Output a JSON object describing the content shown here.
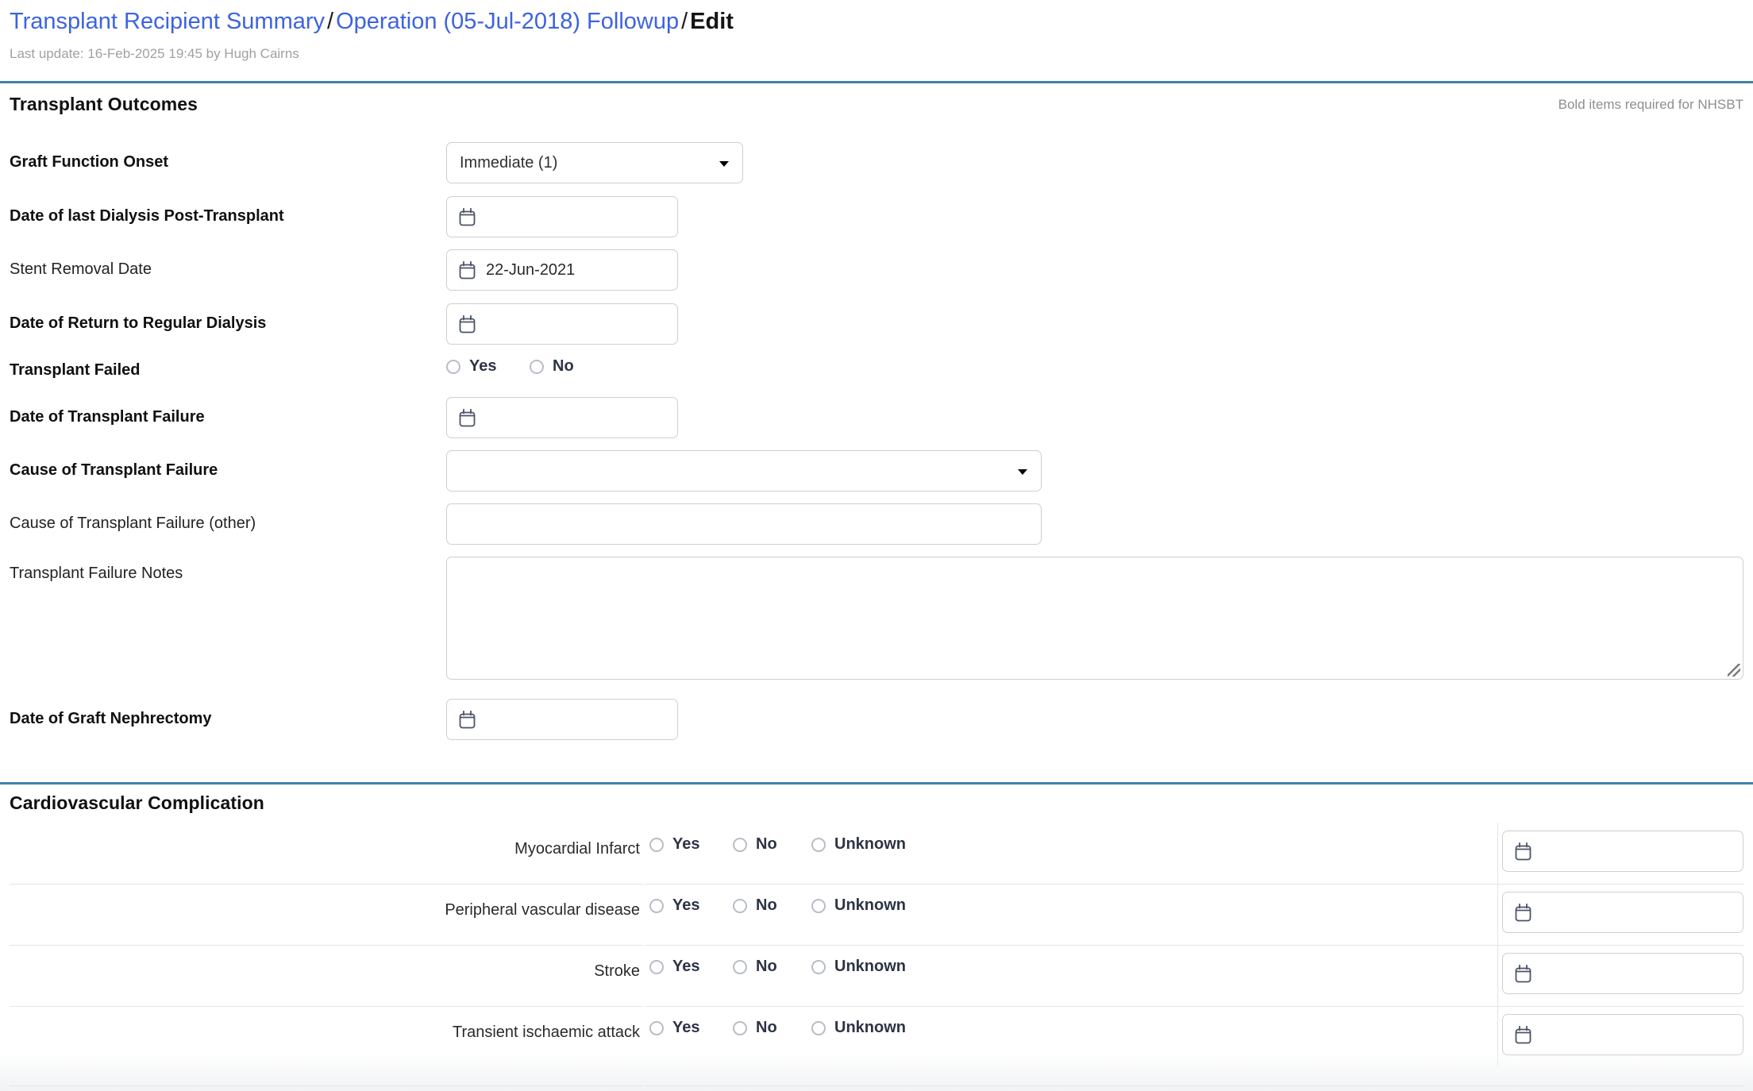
{
  "breadcrumb": {
    "items": [
      {
        "label": "Transplant Recipient Summary",
        "type": "link"
      },
      {
        "label": "Operation (05-Jul-2018) Followup",
        "type": "link"
      },
      {
        "label": "Edit",
        "type": "current"
      }
    ],
    "separator": "/",
    "link_color": "#3d63e0"
  },
  "meta": {
    "last_update": "Last update: 16-Feb-2025 19:45 by Hugh Cairns"
  },
  "sections": {
    "outcomes": {
      "title": "Transplant Outcomes",
      "note": "Bold items required for NHSBT",
      "rows": {
        "graft_function_onset": {
          "label": "Graft Function Onset",
          "value": "Immediate (1)"
        },
        "date_last_dialysis": {
          "label": "Date of last Dialysis Post-Transplant",
          "value": ""
        },
        "stent_removal": {
          "label": "Stent Removal Date",
          "value": "22-Jun-2021"
        },
        "date_return_dialysis": {
          "label": "Date of Return to Regular Dialysis",
          "value": ""
        },
        "transplant_failed": {
          "label": "Transplant Failed",
          "options": [
            "Yes",
            "No"
          ],
          "selected": ""
        },
        "date_transplant_failure": {
          "label": "Date of Transplant Failure",
          "value": ""
        },
        "cause_failure": {
          "label": "Cause of Transplant Failure",
          "value": ""
        },
        "cause_failure_other": {
          "label": "Cause of Transplant Failure (other)",
          "value": ""
        },
        "failure_notes": {
          "label": "Transplant Failure Notes",
          "value": ""
        },
        "date_graft_nephrectomy": {
          "label": "Date of Graft Nephrectomy",
          "value": ""
        }
      }
    },
    "cardiovascular": {
      "title": "Cardiovascular Complication",
      "options": [
        "Yes",
        "No",
        "Unknown"
      ],
      "rows": [
        {
          "label": "Myocardial Infarct",
          "selected": "",
          "date": ""
        },
        {
          "label": "Peripheral vascular disease",
          "selected": "",
          "date": ""
        },
        {
          "label": "Stroke",
          "selected": "",
          "date": ""
        },
        {
          "label": "Transient ischaemic attack",
          "selected": "",
          "date": ""
        }
      ]
    }
  },
  "icons": {
    "calendar": "calendar-icon",
    "caret": "chevron-down-icon",
    "resize": "resize-grip-icon"
  },
  "colors": {
    "rule_blue": "#4281a6",
    "link": "#3d63e0",
    "muted": "#a0a0a0",
    "border": "#cfcfcf"
  }
}
